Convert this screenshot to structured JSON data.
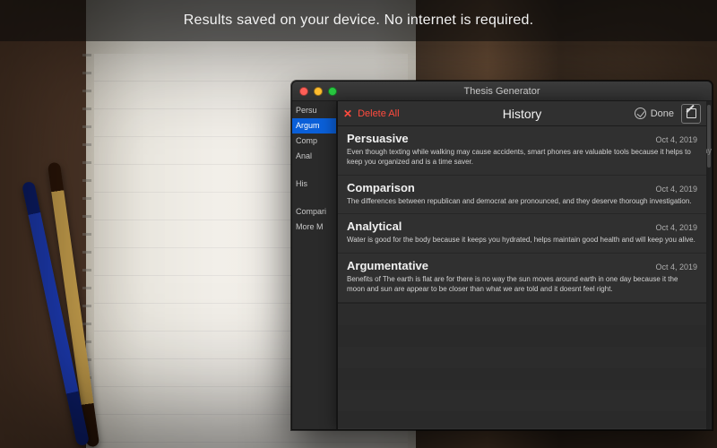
{
  "banner": "Results saved on your device. No internet is required.",
  "window": {
    "title": "Thesis Generator"
  },
  "sidebar": {
    "items": [
      "Persu",
      "Argum",
      "Comp",
      "Anal",
      "",
      "His",
      "",
      "Compari",
      "More M"
    ],
    "selected_index": 1
  },
  "sheet": {
    "title": "History",
    "delete_label": "Delete All",
    "done_label": "Done"
  },
  "edge_label": "lay",
  "entries": [
    {
      "type": "Persuasive",
      "date": "Oct 4, 2019",
      "body": "Even though texting while walking may cause accidents, smart phones are valuable tools because it helps to keep you organized and is a time saver."
    },
    {
      "type": "Comparison",
      "date": "Oct 4, 2019",
      "body": "The differences between republican and democrat are pronounced, and they deserve thorough investigation."
    },
    {
      "type": "Analytical",
      "date": "Oct 4, 2019",
      "body": "Water is good for the body because it keeps you hydrated, helps maintain good health and will keep you alive."
    },
    {
      "type": "Argumentative",
      "date": "Oct 4, 2019",
      "body": "Benefits of The earth is flat are for there is no way the sun moves around earth in one day because it the moon and sun are appear to be closer than what we are told and it doesnt feel right."
    }
  ]
}
